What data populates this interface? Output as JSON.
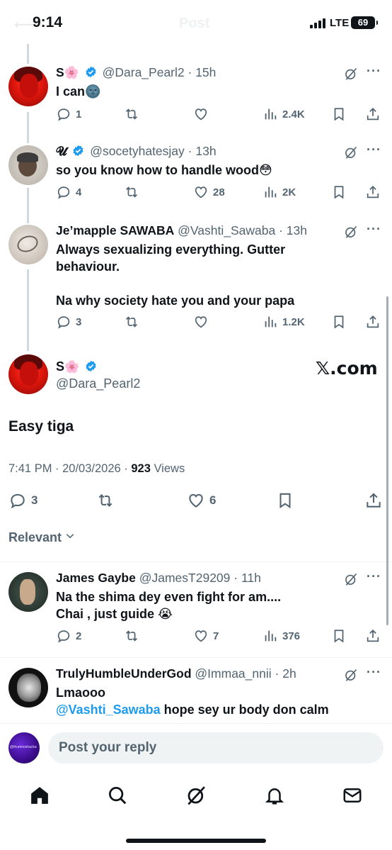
{
  "status_bar": {
    "time": "9:14",
    "network": "LTE",
    "battery": "69"
  },
  "header_ghost": {
    "title": "Post"
  },
  "thread": [
    {
      "name": "S",
      "emoji": "🌸",
      "verified": true,
      "handle": "@Dara_Pearl2",
      "time": "15h",
      "text": "I can🌚",
      "replies": "1",
      "reposts": "",
      "likes": "",
      "views": "2.4K"
    },
    {
      "name": "𝓤",
      "emoji": "",
      "verified": true,
      "handle": "@socetyhatesjay",
      "time": "13h",
      "text": "so you know how to handle wood😳",
      "replies": "4",
      "reposts": "",
      "likes": "28",
      "views": "2K"
    },
    {
      "name": "Je’mapple SAWABA",
      "emoji": "",
      "verified": false,
      "handle": "@Vashti_Sawaba",
      "time": "13h",
      "text_line1": "Always sexualizing everything. Gutter",
      "text_line2": "behaviour.",
      "text_line3": "Na why society hate you and your papa",
      "replies": "3",
      "reposts": "",
      "likes": "",
      "views": "1.2K"
    }
  ],
  "main_post": {
    "name": "S",
    "emoji": "🌸",
    "handle": "@Dara_Pearl2",
    "watermark": "𝕏.com",
    "text": "Easy tiga",
    "timestamp": "7:41 PM · 20/03/2026 · ",
    "views_count": "923",
    "views_label": " Views",
    "replies": "3",
    "reposts": "",
    "likes": "6"
  },
  "sort": {
    "label": "Relevant"
  },
  "replies": [
    {
      "name": "James Gaybe",
      "handle": "@JamesT29209",
      "time": "11h",
      "text_line1": "Na the shima dey even fight for am....",
      "text_line2": "Chai , just guide 😭",
      "replies": "2",
      "reposts": "",
      "likes": "7",
      "views": "376"
    },
    {
      "name": "TrulyHumbleUnderGod",
      "handle": "@Immaa_nnii",
      "time": "2h",
      "text_line1": "Lmaooo",
      "mention": "@Vashti_Sawaba",
      "text_line2_rest": " hope sey ur body don calm"
    }
  ],
  "reply_bar": {
    "placeholder": "Post your reply",
    "avatar_text": "@thumnoshacka"
  },
  "colors": {
    "accent": "#1d9bf0",
    "text": "#0f1419",
    "secondary": "#536471"
  }
}
